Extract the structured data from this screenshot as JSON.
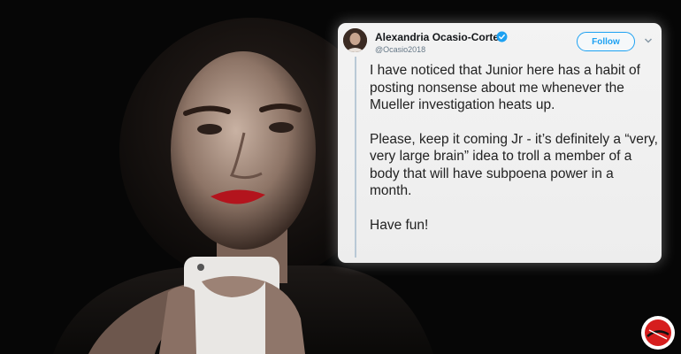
{
  "tweet": {
    "author_name": "Alexandria Ocasio-Cortez",
    "author_handle": "@Ocasio2018",
    "follow_label": "Follow",
    "paragraphs": [
      "I have noticed that Junior here has a habit of posting nonsense about me whenever the Mueller investigation heats up.",
      "Please, keep it coming Jr - it’s definitely a “very, very large brain” idea to troll a member of a body that will have subpoena power in a month.",
      "Have fun!"
    ]
  },
  "icons": {
    "verified": "verified-badge-icon",
    "chevron": "chevron-down-icon",
    "logo": "site-logo"
  },
  "colors": {
    "accent": "#1da1f2",
    "card": "#f0f0f0",
    "text": "#222222",
    "logo_red": "#d61e1e"
  }
}
